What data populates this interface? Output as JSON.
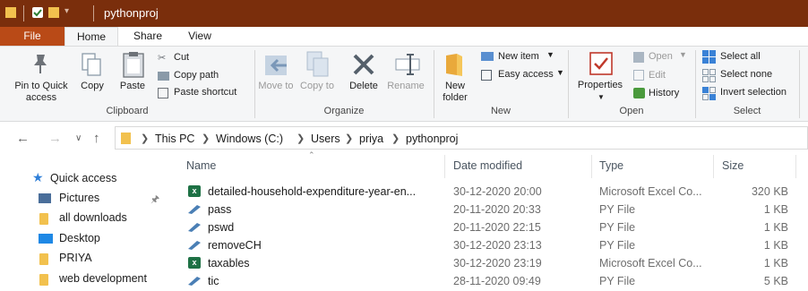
{
  "window": {
    "title": "pythonproj"
  },
  "tabs": [
    {
      "label": "File"
    },
    {
      "label": "Home"
    },
    {
      "label": "Share"
    },
    {
      "label": "View"
    }
  ],
  "ribbon": {
    "clipboard": {
      "pin": "Pin to Quick access",
      "copy": "Copy",
      "paste": "Paste",
      "cut": "Cut",
      "copy_path": "Copy path",
      "paste_shortcut": "Paste shortcut",
      "label": "Clipboard"
    },
    "organize": {
      "move_to": "Move to",
      "copy_to": "Copy to",
      "delete": "Delete",
      "rename": "Rename",
      "label": "Organize"
    },
    "new": {
      "new_folder": "New folder",
      "new_item": "New item",
      "easy_access": "Easy access",
      "label": "New"
    },
    "open": {
      "properties": "Properties",
      "open": "Open",
      "edit": "Edit",
      "history": "History",
      "label": "Open"
    },
    "select": {
      "select_all": "Select all",
      "select_none": "Select none",
      "invert": "Invert selection",
      "label": "Select"
    }
  },
  "address": {
    "crumbs": [
      "This PC",
      "Windows (C:)",
      "Users",
      "priya",
      "pythonproj"
    ]
  },
  "nav": {
    "items": [
      {
        "label": "Quick access",
        "icon": "star-icon"
      },
      {
        "label": "Pictures",
        "icon": "pictures-icon"
      },
      {
        "label": "all downloads",
        "icon": "folder-icon"
      },
      {
        "label": "Desktop",
        "icon": "desktop-icon"
      },
      {
        "label": "PRIYA",
        "icon": "folder-icon"
      },
      {
        "label": "web development",
        "icon": "folder-icon"
      }
    ]
  },
  "columns": {
    "name": "Name",
    "date": "Date modified",
    "type": "Type",
    "size": "Size"
  },
  "files": [
    {
      "name": "detailed-household-expenditure-year-en...",
      "date": "30-12-2020 20:00",
      "type": "Microsoft Excel Co...",
      "size": "320 KB",
      "kind": "excel"
    },
    {
      "name": "pass",
      "date": "20-11-2020 20:33",
      "type": "PY File",
      "size": "1 KB",
      "kind": "py"
    },
    {
      "name": "pswd",
      "date": "20-11-2020 22:15",
      "type": "PY File",
      "size": "1 KB",
      "kind": "py"
    },
    {
      "name": "removeCH",
      "date": "30-12-2020 23:13",
      "type": "PY File",
      "size": "1 KB",
      "kind": "py"
    },
    {
      "name": "taxables",
      "date": "30-12-2020 23:19",
      "type": "Microsoft Excel Co...",
      "size": "1 KB",
      "kind": "excel"
    },
    {
      "name": "tic",
      "date": "28-11-2020 09:49",
      "type": "PY File",
      "size": "5 KB",
      "kind": "py"
    }
  ]
}
